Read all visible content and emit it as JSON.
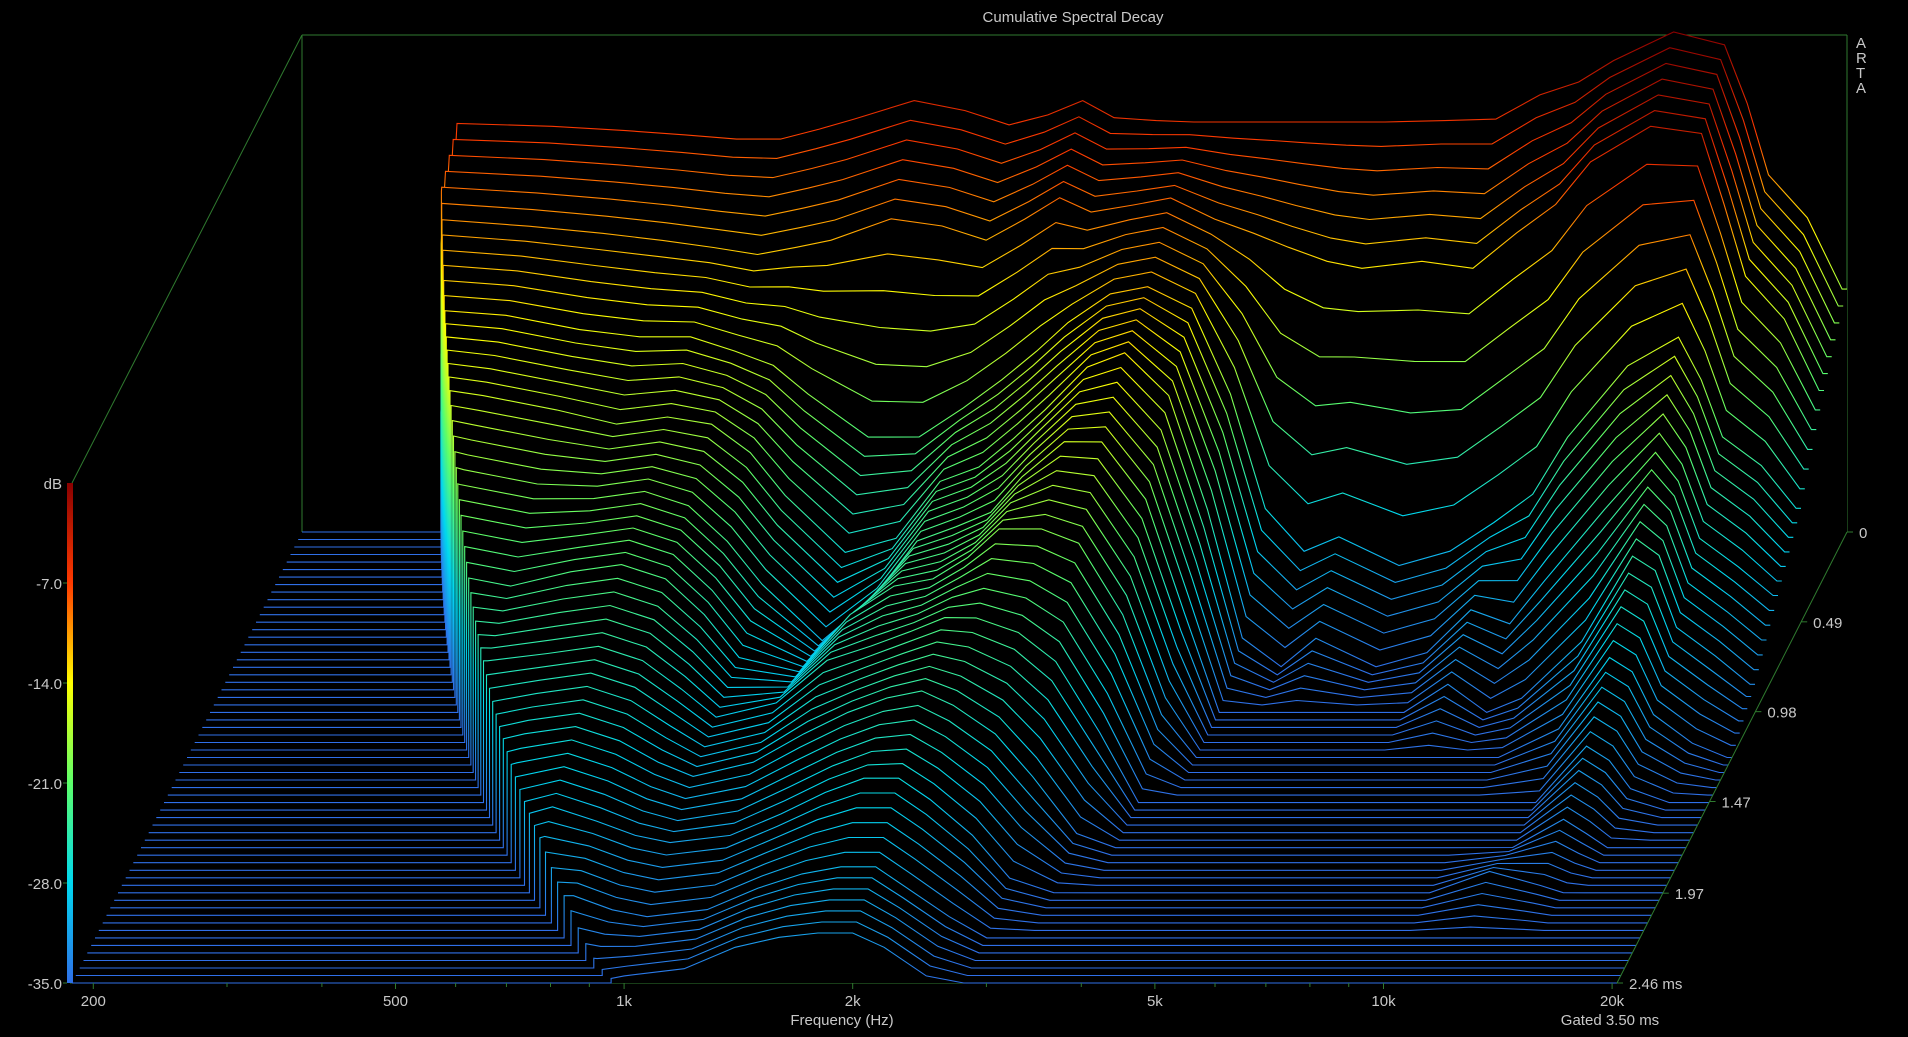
{
  "chart_data": {
    "type": "line",
    "subtype": "waterfall",
    "title": "Cumulative Spectral Decay",
    "watermark": [
      "A",
      "R",
      "T",
      "A"
    ],
    "xlabel": "Frequency (Hz)",
    "x_scale": "log",
    "xlim": [
      187.5,
      20300
    ],
    "x_ticks": [
      {
        "value": 200,
        "label": "200"
      },
      {
        "value": 500,
        "label": "500"
      },
      {
        "value": 1000,
        "label": "1k"
      },
      {
        "value": 2000,
        "label": "2k"
      },
      {
        "value": 5000,
        "label": "5k"
      },
      {
        "value": 10000,
        "label": "10k"
      },
      {
        "value": 20000,
        "label": "20k"
      }
    ],
    "x_minor_ticks": [
      300,
      400,
      600,
      700,
      800,
      900,
      3000,
      4000,
      6000,
      7000,
      8000,
      9000
    ],
    "zlabel": "dB",
    "zlim": [
      -35,
      0
    ],
    "z_ticks": [
      {
        "value": -7,
        "label": "-7.0"
      },
      {
        "value": -14,
        "label": "-14.0"
      },
      {
        "value": -21,
        "label": "-21.0"
      },
      {
        "value": -28,
        "label": "-28.0"
      },
      {
        "value": -35,
        "label": "-35.0"
      }
    ],
    "tlim_ms": [
      0,
      2.46
    ],
    "t_ticks": [
      {
        "value": 0,
        "label": "0"
      },
      {
        "value": 0.49,
        "label": "0.49"
      },
      {
        "value": 0.98,
        "label": "0.98"
      },
      {
        "value": 1.47,
        "label": "1.47"
      },
      {
        "value": 1.97,
        "label": "1.97"
      },
      {
        "value": 2.46,
        "label": "2.46 ms"
      }
    ],
    "gate_ms": 3.5,
    "gate_label": "Gated 3.50 ms",
    "slice_count": 61,
    "colormap": [
      {
        "db": -35,
        "color": "#2f6fe8"
      },
      {
        "db": -28,
        "color": "#00d8f0"
      },
      {
        "db": -21,
        "color": "#5cff6a"
      },
      {
        "db": -14,
        "color": "#ffff00"
      },
      {
        "db": -7,
        "color": "#ff3a00"
      },
      {
        "db": 0,
        "color": "#8a0000"
      }
    ],
    "frequencies": [
      190,
      280,
      300,
      400,
      500,
      600,
      700,
      800,
      900,
      1000,
      1200,
      1400,
      1600,
      1800,
      2000,
      2200,
      2500,
      2800,
      3200,
      3600,
      4000,
      4500,
      5000,
      6000,
      7000,
      8000,
      9000,
      10000,
      12000,
      14000,
      15000,
      16000,
      18000,
      20000
    ],
    "series": [
      {
        "t_ms": 0,
        "values": [
          -35,
          -35,
          -6.4,
          -6.6,
          -6.9,
          -7.2,
          -7.5,
          -7.5,
          -6.8,
          -6.1,
          -4.8,
          -5.5,
          -6.5,
          -5.8,
          -4.8,
          -6.0,
          -6.2,
          -6.3,
          -6.3,
          -6.3,
          -6.3,
          -6.3,
          -6.3,
          -6.2,
          -6.1,
          -4.4,
          -3.5,
          -2.0,
          0,
          -0.9,
          -5,
          -10,
          -13,
          -18
        ]
      },
      {
        "t_ms": 0.25,
        "values": [
          -35,
          -35,
          -10,
          -10.5,
          -11,
          -11.5,
          -12,
          -12.5,
          -12,
          -11.5,
          -10,
          -10.5,
          -11.5,
          -10,
          -8.5,
          -9.5,
          -9,
          -8.5,
          -10,
          -11,
          -12,
          -13,
          -13.5,
          -13,
          -13.5,
          -11,
          -9,
          -6,
          -3.5,
          -4,
          -9,
          -14,
          -17,
          -22
        ]
      },
      {
        "t_ms": 0.49,
        "values": [
          -35,
          -35,
          -13,
          -13.5,
          -14.5,
          -15,
          -15,
          -16,
          -17,
          -19,
          -22,
          -22,
          -20,
          -18,
          -16,
          -14,
          -12,
          -11.5,
          -13,
          -19,
          -27,
          -30,
          -29,
          -31,
          -30,
          -28,
          -26,
          -22,
          -17,
          -15,
          -18,
          -22,
          -24,
          -27
        ]
      },
      {
        "t_ms": 0.74,
        "values": [
          -35,
          -35,
          -15,
          -16,
          -17,
          -18,
          -17.5,
          -18,
          -20,
          -23,
          -27,
          -26,
          -22,
          -21,
          -19,
          -17,
          -14,
          -13,
          -16,
          -24,
          -33,
          -35,
          -33,
          -35,
          -34,
          -31,
          -32,
          -29,
          -24,
          -20,
          -22,
          -26,
          -28,
          -30
        ]
      },
      {
        "t_ms": 0.98,
        "values": [
          -35,
          -35,
          -17,
          -19,
          -20,
          -20,
          -19.5,
          -20.5,
          -23,
          -26,
          -30,
          -27,
          -23,
          -22,
          -21,
          -18.5,
          -16,
          -16,
          -20,
          -28,
          -35,
          -35,
          -35,
          -35,
          -35,
          -33,
          -35,
          -34,
          -30,
          -24,
          -25,
          -29,
          -31,
          -33
        ]
      },
      {
        "t_ms": 1.23,
        "values": [
          -35,
          -35,
          -20,
          -22,
          -23,
          -22,
          -21.5,
          -22.5,
          -25,
          -28,
          -29,
          -25,
          -23,
          -22.5,
          -21,
          -19,
          -19,
          -20,
          -25,
          -32,
          -35,
          -35,
          -35,
          -35,
          -35,
          -35,
          -35,
          -35,
          -33,
          -28,
          -29,
          -32,
          -34,
          -35
        ]
      },
      {
        "t_ms": 1.47,
        "values": [
          -35,
          -35,
          -23,
          -25,
          -25,
          -24.5,
          -24,
          -25,
          -27,
          -29,
          -28,
          -25,
          -24,
          -23,
          -22,
          -22,
          -23,
          -25,
          -30,
          -35,
          -35,
          -35,
          -35,
          -35,
          -35,
          -35,
          -35,
          -35,
          -35,
          -31,
          -32,
          -34,
          -35,
          -35
        ]
      },
      {
        "t_ms": 1.72,
        "values": [
          -35,
          -35,
          -27,
          -28.5,
          -28,
          -27,
          -26.5,
          -27.5,
          -29,
          -30,
          -29,
          -27,
          -25.5,
          -24.5,
          -24,
          -25,
          -27,
          -30,
          -34,
          -35,
          -35,
          -35,
          -35,
          -35,
          -35,
          -35,
          -35,
          -35,
          -35,
          -33,
          -34,
          -35,
          -35,
          -35
        ]
      },
      {
        "t_ms": 1.97,
        "values": [
          -35,
          -35,
          -31,
          -32,
          -31.5,
          -30,
          -29,
          -30,
          -31,
          -31.5,
          -31,
          -29.5,
          -28,
          -27,
          -27,
          -28.5,
          -31,
          -34,
          -35,
          -35,
          -35,
          -35,
          -35,
          -35,
          -35,
          -35,
          -35,
          -35,
          -33.5,
          -34.5,
          -35,
          -35,
          -35,
          -35
        ]
      },
      {
        "t_ms": 2.21,
        "values": [
          -35,
          -35,
          -34,
          -34.5,
          -34,
          -33,
          -32,
          -32,
          -33,
          -33.5,
          -33,
          -31.5,
          -30.5,
          -30,
          -30,
          -31.5,
          -33.5,
          -35,
          -35,
          -35,
          -35,
          -35,
          -35,
          -35,
          -35,
          -35,
          -35,
          -35,
          -35,
          -35,
          -35,
          -35,
          -35,
          -35
        ]
      },
      {
        "t_ms": 2.46,
        "values": [
          -35,
          -35,
          -35,
          -35,
          -35,
          -35,
          -35,
          -35,
          -35,
          -34.5,
          -34,
          -32.5,
          -31.8,
          -31.5,
          -31.5,
          -32.5,
          -34.5,
          -35,
          -35,
          -35,
          -35,
          -35,
          -35,
          -35,
          -35,
          -35,
          -35,
          -35,
          -35,
          -35,
          -35,
          -35,
          -35,
          -35
        ]
      }
    ]
  }
}
